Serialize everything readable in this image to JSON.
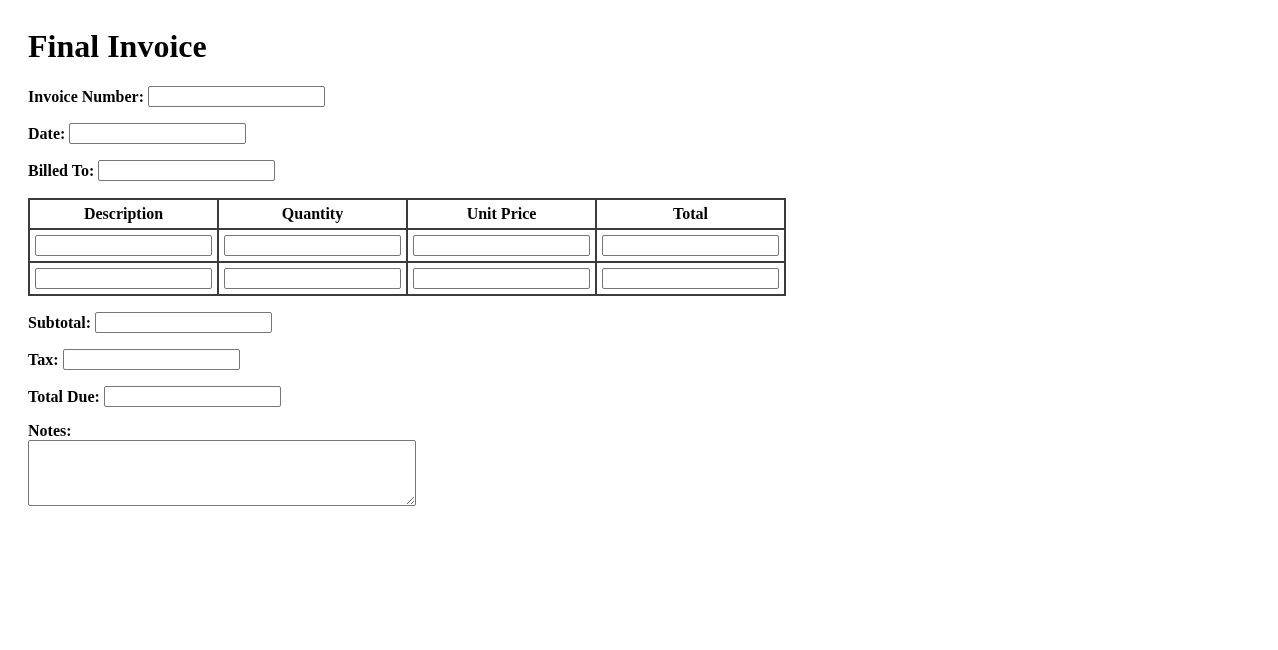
{
  "title": "Final Invoice",
  "header_fields": [
    {
      "label": "Invoice Number:"
    },
    {
      "label": "Date:"
    },
    {
      "label": "Billed To:"
    }
  ],
  "table": {
    "columns": [
      "Description",
      "Quantity",
      "Unit Price",
      "Total"
    ],
    "rows": [
      {
        "cells": [
          {
            "kind": "input"
          },
          {
            "kind": "input"
          },
          {
            "kind": "input"
          },
          {
            "kind": "input"
          }
        ]
      },
      {
        "cells": [
          {
            "kind": "input"
          },
          {
            "kind": "input"
          },
          {
            "kind": "input"
          },
          {
            "kind": "input"
          }
        ]
      }
    ]
  },
  "summary_fields": [
    {
      "label": "Subtotal:",
      "kind": "input"
    },
    {
      "label": "Tax:",
      "kind": "input"
    },
    {
      "label": "Total Due:",
      "kind": "input"
    },
    {
      "label": "Notes:",
      "kind": "textarea"
    }
  ]
}
